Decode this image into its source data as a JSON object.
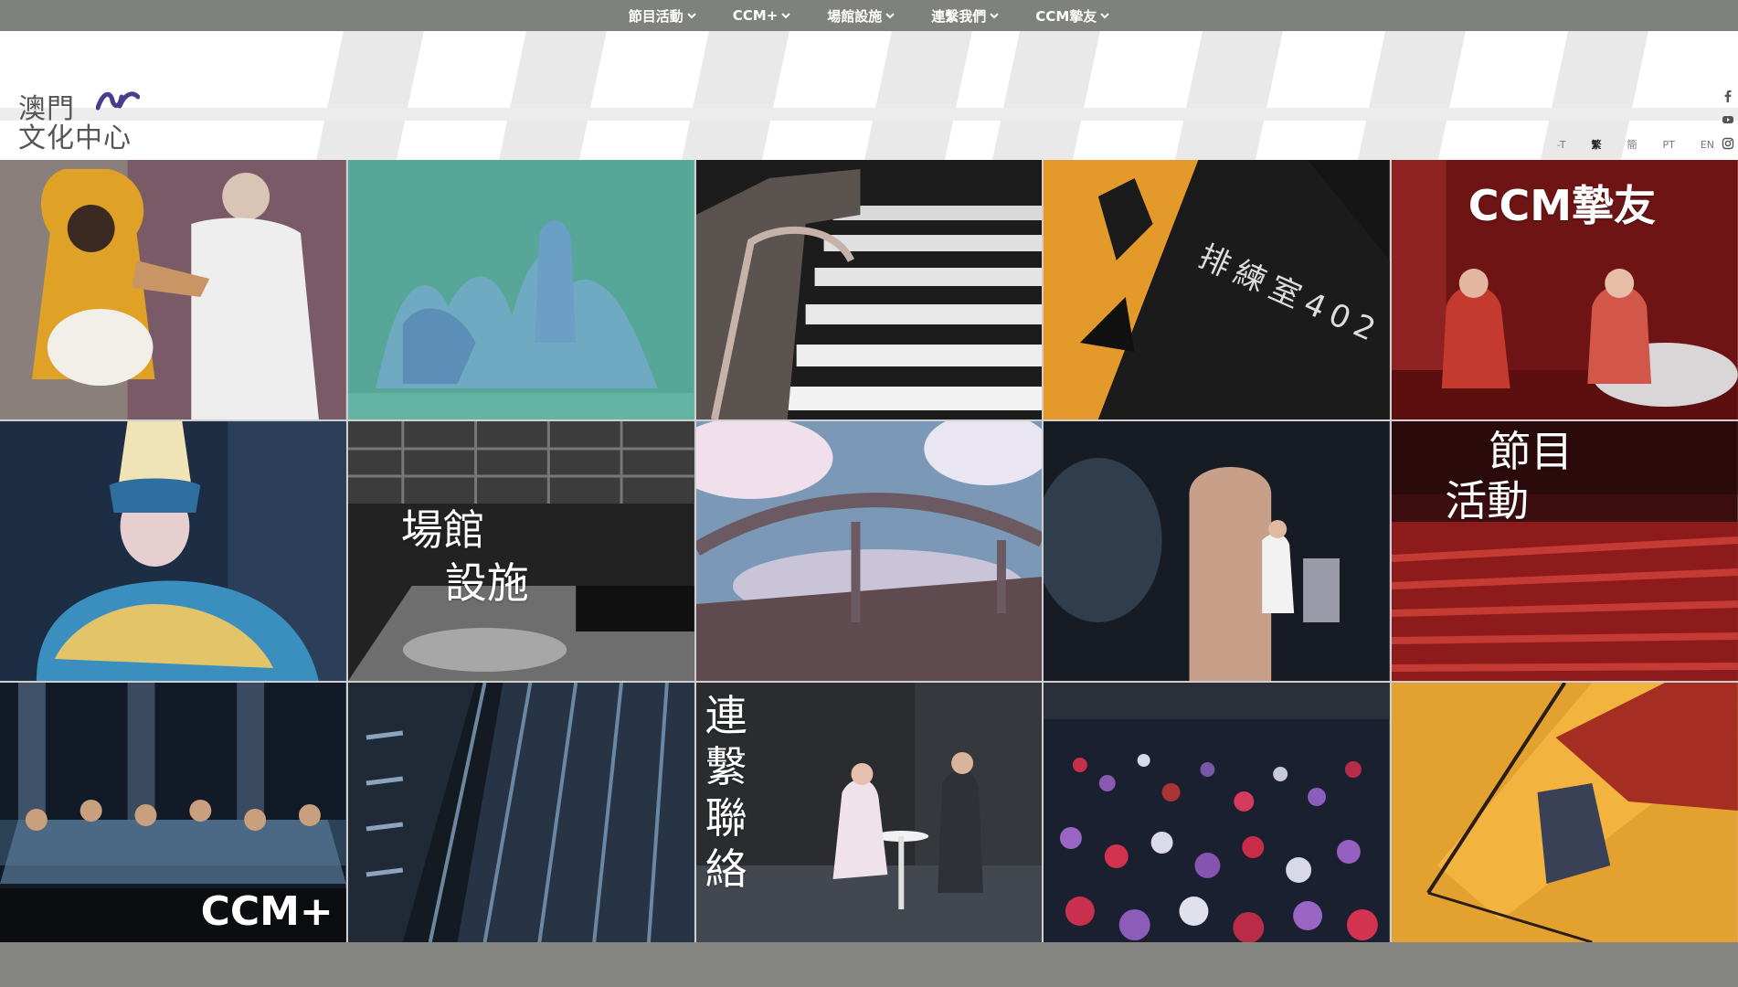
{
  "nav": {
    "items": [
      {
        "label": "節目活動"
      },
      {
        "label": "CCM+"
      },
      {
        "label": "場館設施"
      },
      {
        "label": "連繫我們"
      },
      {
        "label": "CCM摯友"
      }
    ]
  },
  "logo": {
    "line1": "澳門",
    "line2": "文化中心"
  },
  "social": [
    "facebook-icon",
    "youtube-icon",
    "instagram-icon",
    "wechat-icon"
  ],
  "lang": {
    "font_size": "-T",
    "trad": "繁",
    "simp": "簡",
    "pt": "PT",
    "en": "EN"
  },
  "tiles": {
    "friends": "CCM摯友",
    "venues_1": "場館",
    "venues_2": "設施",
    "events_1": "節目",
    "events_2": "活動",
    "ccmplus": "CCM+",
    "contact": "連繫聯絡",
    "room_sign": "排練室402"
  },
  "colors": {
    "nav_bg": "#7f817d",
    "page_bg": "#868783"
  }
}
